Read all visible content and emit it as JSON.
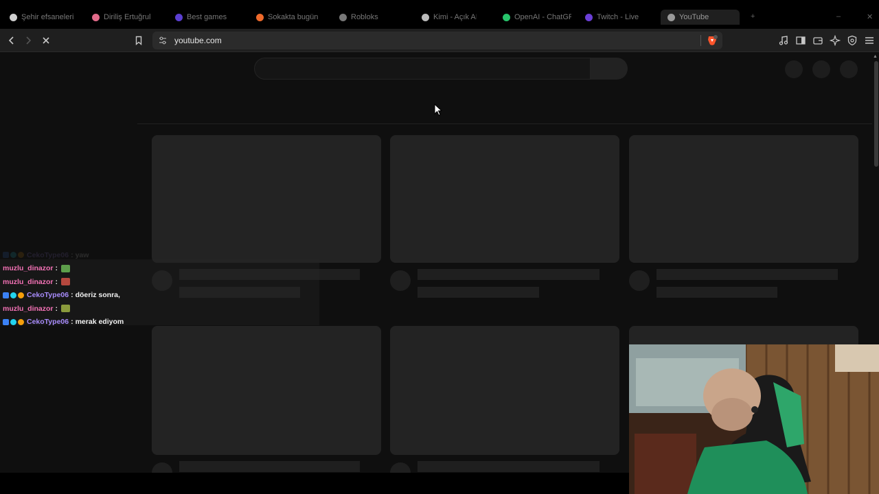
{
  "browser": {
    "tabs": [
      {
        "label": "Şehir efsaneleri",
        "favicon_color": "#cfcfcf"
      },
      {
        "label": "Diriliş Ertuğrul",
        "favicon_color": "#e26b8a"
      },
      {
        "label": "Best games",
        "favicon_color": "#5b3fd1"
      },
      {
        "label": "Sokakta bugün",
        "favicon_color": "#ef6a2b"
      },
      {
        "label": "Robloks",
        "favicon_color": "#777777"
      },
      {
        "label": "Kimi - Açık AI",
        "favicon_color": "#bbbbbb"
      },
      {
        "label": "OpenAI - ChatGPT",
        "favicon_color": "#27c46b"
      },
      {
        "label": "Twitch - Live",
        "favicon_color": "#6b3fd6"
      },
      {
        "label": "YouTube",
        "favicon_color": "#999999"
      }
    ],
    "url": "youtube.com",
    "icons": {
      "back": "arrow-left-icon",
      "forward": "arrow-right-icon",
      "stop": "close-icon",
      "bookmark": "bookmark-icon",
      "site_info": "tune-icon",
      "brave_shields": "brave-lion-icon",
      "media": "music-note-icon",
      "sidebar": "sidebar-icon",
      "wallet": "wallet-icon",
      "leo": "sparkle-icon",
      "vpn": "shield-icon",
      "menu": "hamburger-menu-icon"
    }
  },
  "chat": {
    "messages": [
      {
        "user": "CekoType06",
        "text": "yaw",
        "user_color": "#a78bfa",
        "badges": true,
        "faded": true
      },
      {
        "user": "muzlu_dinazor",
        "text": "",
        "user_color": "#f472b6",
        "badges": false,
        "emote_color": "#5d9e4b"
      },
      {
        "user": "muzlu_dinazor",
        "text": "",
        "user_color": "#f472b6",
        "badges": false,
        "emote_color": "#b5483e"
      },
      {
        "user": "CekoType06",
        "text": "döeriz sonra,",
        "user_color": "#a78bfa",
        "badges": true
      },
      {
        "user": "muzlu_dinazor",
        "text": "",
        "user_color": "#f472b6",
        "badges": false,
        "emote_color": "#8a9a3c"
      },
      {
        "user": "CekoType06",
        "text": "merak ediyom",
        "user_color": "#a78bfa",
        "badges": true
      }
    ],
    "separator": ":"
  },
  "colors": {
    "page_bg": "#0f0f0f",
    "skeleton": "#232323",
    "toolbar": "#1f1f1f"
  }
}
